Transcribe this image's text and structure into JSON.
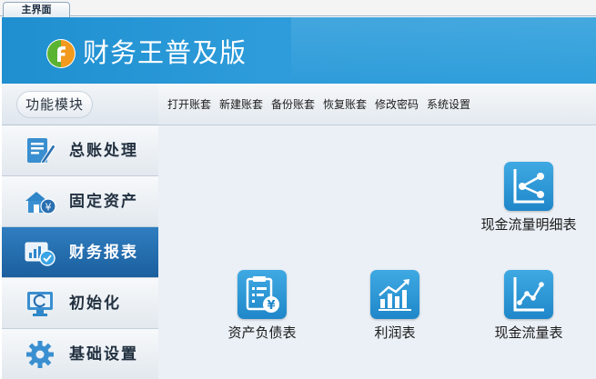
{
  "tab": {
    "label": "主界面"
  },
  "header": {
    "title": "财务王普及版",
    "logo_letter": "f"
  },
  "sidebar": {
    "title": "功能模块",
    "items": [
      {
        "label": "总账处理",
        "icon": "ledger-pencil-icon",
        "active": false
      },
      {
        "label": "固定资产",
        "icon": "house-yen-icon",
        "active": false
      },
      {
        "label": "财务报表",
        "icon": "report-check-icon",
        "active": true
      },
      {
        "label": "初始化",
        "icon": "monitor-refresh-icon",
        "active": false
      },
      {
        "label": "基础设置",
        "icon": "gear-icon",
        "active": false
      }
    ]
  },
  "toolbar": {
    "items": [
      "打开账套",
      "新建账套",
      "备份账套",
      "恢复账套",
      "修改密码",
      "系统设置"
    ]
  },
  "reports": [
    {
      "label": "现金流量明细表",
      "icon": "share-nodes-icon"
    },
    {
      "label": "资产负债表",
      "icon": "balance-sheet-icon"
    },
    {
      "label": "利润表",
      "icon": "bar-chart-up-icon"
    },
    {
      "label": "现金流量表",
      "icon": "line-chart-icon"
    }
  ],
  "colors": {
    "banner": "#2e9cda",
    "accent": "#1f87c9",
    "active_nav": "#1b5f9e",
    "main_bg": "#eaf0f6"
  }
}
